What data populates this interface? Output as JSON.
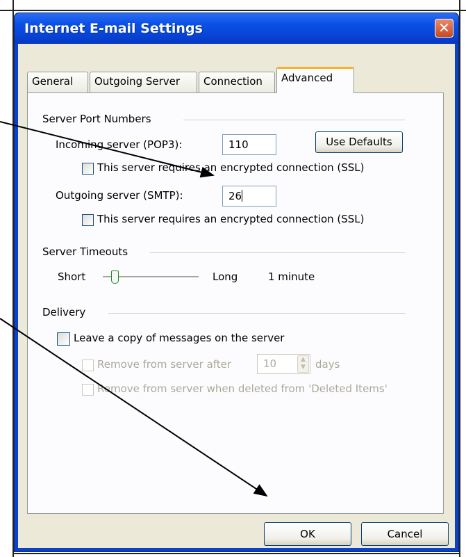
{
  "window": {
    "title": "Internet E-mail Settings",
    "close_glyph": "✕"
  },
  "tabs": [
    {
      "label": "General",
      "active": false
    },
    {
      "label": "Outgoing Server",
      "active": false
    },
    {
      "label": "Connection",
      "active": false
    },
    {
      "label": "Advanced",
      "active": true
    }
  ],
  "server_ports": {
    "group_label": "Server Port Numbers",
    "incoming_label": "Incoming server (POP3):",
    "incoming_value": "110",
    "use_defaults": "Use Defaults",
    "incoming_ssl": "This server requires an encrypted connection (SSL)",
    "outgoing_label": "Outgoing server (SMTP):",
    "outgoing_value": "26",
    "outgoing_ssl": "This server requires an encrypted connection (SSL)"
  },
  "timeouts": {
    "group_label": "Server Timeouts",
    "short_label": "Short",
    "long_label": "Long",
    "value": "1 minute",
    "slider_position": 0.12
  },
  "delivery": {
    "group_label": "Delivery",
    "leave_copy": "Leave a copy of messages on the server",
    "remove_after_label": "Remove from server after",
    "remove_after_value": "10",
    "days_label": "days",
    "remove_deleted": "Remove from server when deleted from 'Deleted Items'"
  },
  "buttons": {
    "ok": "OK",
    "cancel": "Cancel"
  },
  "colors": {
    "titlebar": "#0b51e6",
    "client": "#ece9d8",
    "arrow": "#000000"
  }
}
